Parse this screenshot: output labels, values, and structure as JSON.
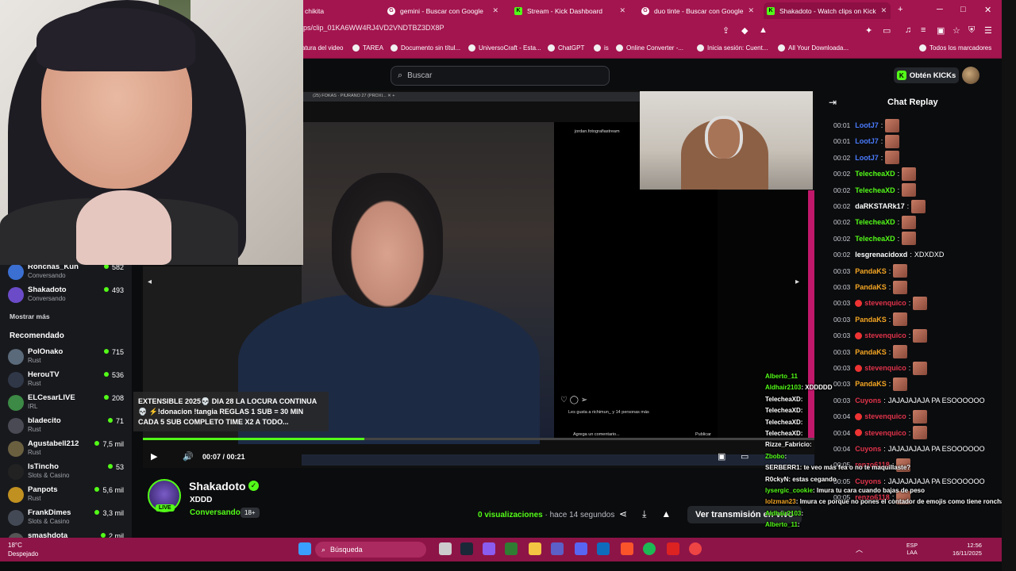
{
  "browser": {
    "tabs": [
      {
        "label": "chikita",
        "active": false
      },
      {
        "label": "gemini - Buscar con Google",
        "active": false
      },
      {
        "label": "Stream - Kick Dashboard",
        "active": false
      },
      {
        "label": "duo tinte - Buscar con Google",
        "active": false
      },
      {
        "label": "Shakadoto - Watch clips on Kick",
        "active": true
      }
    ],
    "url": "ips/clip_01KA6WW4RJ4VD2VNDTBZ3DX8P",
    "bookmarks": [
      "atura del video",
      "TAREA",
      "Documento sin títul...",
      "UniversoCraft - Esta...",
      "ChatGPT",
      "is",
      "Online Converter -...",
      "Inicia sesión: Cuent...",
      "All Your Downloada...",
      "Todos los marcadores"
    ]
  },
  "header": {
    "search_placeholder": "Buscar",
    "get_kicks": "Obtén KICKs"
  },
  "sidebar": {
    "following": [
      {
        "name": "Ronchas_Kun",
        "category": "Conversando",
        "viewers": "582",
        "color": "#3b6fd1"
      },
      {
        "name": "Shakadoto",
        "category": "Conversando",
        "viewers": "493",
        "color": "#6b4bc8"
      }
    ],
    "show_more": "Mostrar más",
    "recommended_title": "Recomendado",
    "recommended": [
      {
        "name": "PolOnako",
        "category": "Rust",
        "viewers": "715",
        "color": "#5a6a7a"
      },
      {
        "name": "HerouTV",
        "category": "Rust",
        "viewers": "536",
        "color": "#303848"
      },
      {
        "name": "ELCesarLIVE",
        "category": "IRL",
        "viewers": "208",
        "color": "#3c8a45"
      },
      {
        "name": "bladecito",
        "category": "Rust",
        "viewers": "71",
        "color": "#4a4a55"
      },
      {
        "name": "Agustabell212",
        "category": "Rust",
        "viewers": "7,5 mil",
        "color": "#6a6040"
      },
      {
        "name": "IsTincho",
        "category": "Slots & Casino",
        "viewers": "53",
        "color": "#222"
      },
      {
        "name": "Panpots",
        "category": "Rust",
        "viewers": "5,6 mil",
        "color": "#c09020"
      },
      {
        "name": "FrankDimes",
        "category": "Slots & Casino",
        "viewers": "3,3 mil",
        "color": "#444a55"
      },
      {
        "name": "smashdota",
        "category": "",
        "viewers": "2 mil",
        "color": "#555"
      }
    ]
  },
  "video": {
    "overlay_title": "EXTENSIBLE 2025💀 DIA 28 LA LOCURA CONTINUA 💀 ⚡!donacion !tangia REGLAS 1 SUB = 30 MIN CADA 5 SUB COMPLETO TIME X2 A TODO...",
    "time_current": "00:07",
    "time_total": "00:21",
    "progress": 0.33,
    "ig_user": "jordan.fotografiastream",
    "ig_likes": "Les gusta a richimun_ y 14 personas más",
    "ig_comment": "Agrega un comentario...",
    "ig_publish": "Publicar"
  },
  "channel": {
    "name": "Shakadoto",
    "live": "LIVE",
    "title": "XDDD",
    "category": "Conversando",
    "age": "18+",
    "views": "0 visualizaciones",
    "ago": "· hace 14 segundos",
    "watch_button": "Ver transmisión en vivo"
  },
  "chat": {
    "title": "Chat Replay",
    "messages": [
      {
        "t": "00:01",
        "u": "LootJ7",
        "c": "#4a7cff",
        "m": "",
        "e": true
      },
      {
        "t": "00:01",
        "u": "LootJ7",
        "c": "#4a7cff",
        "m": "",
        "e": true
      },
      {
        "t": "00:02",
        "u": "LootJ7",
        "c": "#4a7cff",
        "m": "",
        "e": true
      },
      {
        "t": "00:02",
        "u": "TelecheaXD",
        "c": "#53fc18",
        "m": "",
        "e": true
      },
      {
        "t": "00:02",
        "u": "TelecheaXD",
        "c": "#53fc18",
        "m": "",
        "e": true
      },
      {
        "t": "00:02",
        "u": "daRKSTARk17",
        "c": "#ffffff",
        "m": "",
        "e": true
      },
      {
        "t": "00:02",
        "u": "TelecheaXD",
        "c": "#53fc18",
        "m": "",
        "e": true
      },
      {
        "t": "00:02",
        "u": "TelecheaXD",
        "c": "#53fc18",
        "m": "",
        "e": true
      },
      {
        "t": "00:02",
        "u": "lesgrenacidoxd",
        "c": "#ffffff",
        "m": "XDXDXD",
        "e": false
      },
      {
        "t": "00:03",
        "u": "PandaKS",
        "c": "#f5a623",
        "m": "",
        "e": true
      },
      {
        "t": "00:03",
        "u": "PandaKS",
        "c": "#f5a623",
        "m": "",
        "e": true
      },
      {
        "t": "00:03",
        "u": "stevenquico",
        "c": "#e0334a",
        "m": "",
        "e": true
      },
      {
        "t": "00:03",
        "u": "PandaKS",
        "c": "#f5a623",
        "m": "",
        "e": true
      },
      {
        "t": "00:03",
        "u": "stevenquico",
        "c": "#e0334a",
        "m": "",
        "e": true
      },
      {
        "t": "00:03",
        "u": "PandaKS",
        "c": "#f5a623",
        "m": "",
        "e": true
      },
      {
        "t": "00:03",
        "u": "stevenquico",
        "c": "#e0334a",
        "m": "",
        "e": true
      },
      {
        "t": "00:03",
        "u": "PandaKS",
        "c": "#f5a623",
        "m": "",
        "e": true
      },
      {
        "t": "00:03",
        "u": "Cuyons",
        "c": "#e0334a",
        "m": "JAJAJAJAJA PA ESOOOOOO",
        "e": false
      },
      {
        "t": "00:04",
        "u": "stevenquico",
        "c": "#e0334a",
        "m": "",
        "e": true
      },
      {
        "t": "00:04",
        "u": "stevenquico",
        "c": "#e0334a",
        "m": "",
        "e": true
      },
      {
        "t": "00:04",
        "u": "Cuyons",
        "c": "#e0334a",
        "m": "JAJAJAJAJA PA ESOOOOOO",
        "e": false
      },
      {
        "t": "00:05",
        "u": "renzo6118",
        "c": "#e0334a",
        "m": "",
        "e": true
      },
      {
        "t": "00:05",
        "u": "Cuyons",
        "c": "#e0334a",
        "m": "JAJAJAJAJA PA ESOOOOOO",
        "e": false
      },
      {
        "t": "00:05",
        "u": "renzo6118",
        "c": "#e0334a",
        "m": "",
        "e": true
      }
    ]
  },
  "overlay_chat": [
    {
      "u": "Alberto_11",
      "c": "#53fc18",
      "m": ""
    },
    {
      "u": "Aldhair2103",
      "c": "#53fc18",
      "m": ": XDDDDD"
    },
    {
      "u": "TelecheaXD",
      "c": "#ffffff",
      "m": ":"
    },
    {
      "u": "TelecheaXD",
      "c": "#ffffff",
      "m": ":"
    },
    {
      "u": "TelecheaXD",
      "c": "#ffffff",
      "m": ":"
    },
    {
      "u": "TelecheaXD",
      "c": "#ffffff",
      "m": ":"
    },
    {
      "u": "Rizze_Fabricio",
      "c": "#ffffff",
      "m": ":"
    },
    {
      "u": "Zbobo",
      "c": "#53fc18",
      "m": ":"
    },
    {
      "u": "SERBERR1",
      "c": "#ffffff",
      "m": ": te veo más fea o no te maquillaste?"
    },
    {
      "u": "R0ckyN",
      "c": "#ffffff",
      "m": ": estas cegando"
    },
    {
      "u": "lysergic_cookie",
      "c": "#53fc18",
      "m": ": lmura tu cara cuando bajas de peso"
    },
    {
      "u": "lolzman23",
      "c": "#f5a623",
      "m": ": lmura ce porque no pones el contador de emojis como tiene ronchas"
    },
    {
      "u": "Aldhair2103",
      "c": "#53fc18",
      "m": ":"
    },
    {
      "u": "Alberto_11",
      "c": "#53fc18",
      "m": ":"
    }
  ],
  "taskbar": {
    "weather_temp": "18°C",
    "weather_desc": "Despejado",
    "search": "Búsqueda",
    "lang": "ESP",
    "lang2": "LAA",
    "time": "12:56",
    "date": "16/11/2025"
  }
}
